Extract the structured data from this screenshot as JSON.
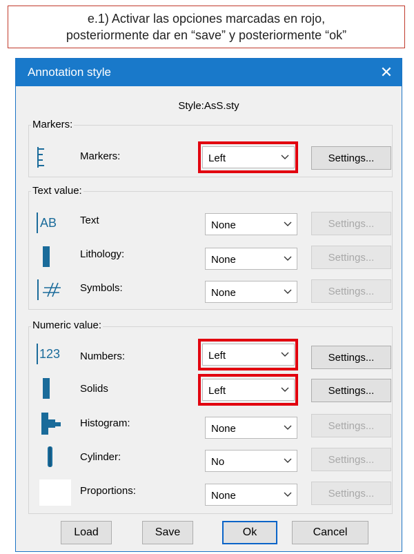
{
  "instruction": {
    "line1": "e.1) Activar las opciones marcadas en rojo,",
    "line2": "posteriormente dar en “save” y posteriormente “ok”"
  },
  "dialog": {
    "title": "Annotation style",
    "close_glyph": "✕",
    "style_name": "Style:AsS.sty",
    "groups": {
      "markers": "Markers:",
      "text_value": "Text value:",
      "numeric_value": "Numeric value:"
    },
    "rows": {
      "markers": {
        "label": "Markers:",
        "value": "Left",
        "settings": "Settings...",
        "enabled": true,
        "highlighted": true,
        "icon": "markers-scale-icon"
      },
      "text": {
        "label": "Text",
        "value": "None",
        "settings": "Settings...",
        "enabled": false,
        "highlighted": false,
        "icon": "ab-text-icon",
        "icon_text": "AB"
      },
      "lithology": {
        "label": "Lithology:",
        "value": "None",
        "settings": "Settings...",
        "enabled": false,
        "highlighted": false,
        "icon": "lithology-bar-icon"
      },
      "symbols": {
        "label": "Symbols:",
        "value": "None",
        "settings": "Settings...",
        "enabled": false,
        "highlighted": false,
        "icon": "hash-symbols-icon"
      },
      "numbers": {
        "label": "Numbers:",
        "value": "Left",
        "settings": "Settings...",
        "enabled": true,
        "highlighted": true,
        "icon": "123-numbers-icon",
        "icon_text": "123"
      },
      "solids": {
        "label": "Solids",
        "value": "Left",
        "settings": "Settings...",
        "enabled": true,
        "highlighted": true,
        "icon": "solids-bar-icon"
      },
      "histogram": {
        "label": "Histogram:",
        "value": "None",
        "settings": "Settings...",
        "enabled": false,
        "highlighted": false,
        "icon": "histogram-icon"
      },
      "cylinder": {
        "label": "Cylinder:",
        "value": "No",
        "settings": "Settings...",
        "enabled": false,
        "highlighted": false,
        "icon": "cylinder-icon"
      },
      "proportions": {
        "label": "Proportions:",
        "value": "None",
        "settings": "Settings...",
        "enabled": false,
        "highlighted": false,
        "icon": "proportions-blank-icon"
      }
    },
    "buttons": {
      "load": "Load",
      "save": "Save",
      "ok": "Ok",
      "cancel": "Cancel"
    },
    "colors": {
      "titlebar": "#1979ca",
      "highlight": "#e2000f",
      "icon": "#1a6b9a"
    }
  }
}
